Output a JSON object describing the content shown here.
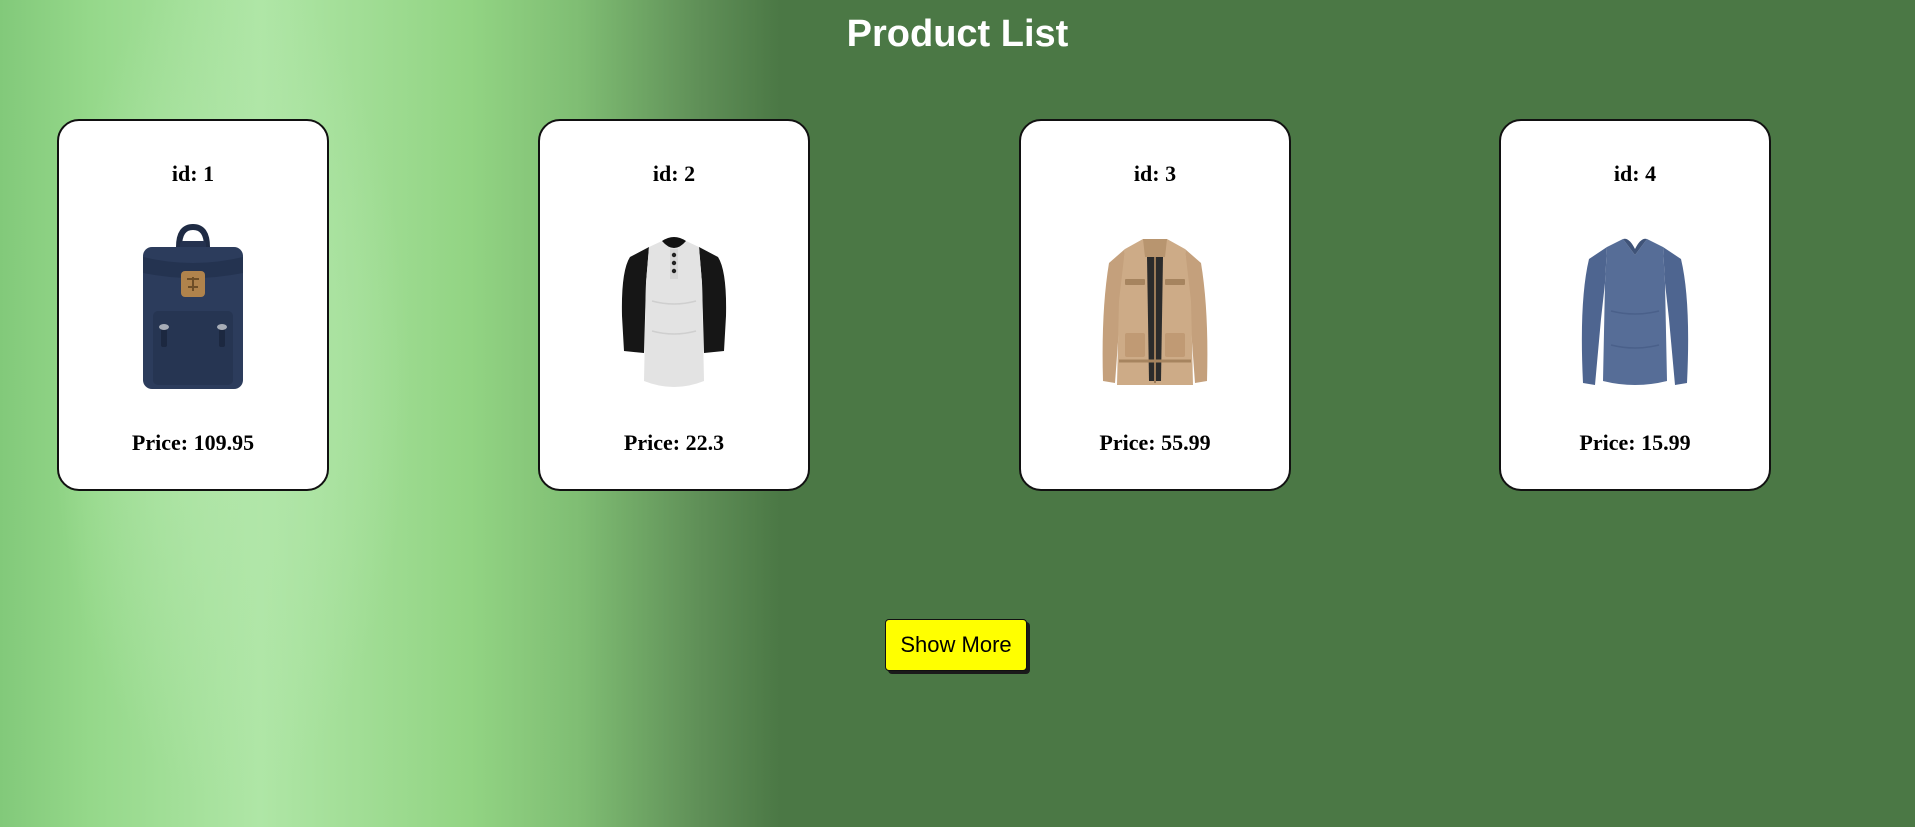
{
  "page": {
    "title": "Product List",
    "background_color": "#4b7845",
    "background_highlight": "#afe6a6"
  },
  "products": [
    {
      "id_label": "id: 1",
      "price_label": "Price: 109.95",
      "image_icon": "backpack-icon",
      "image_color": "#2c3c5c"
    },
    {
      "id_label": "id: 2",
      "price_label": "Price: 22.3",
      "image_icon": "raglan-shirt-icon",
      "image_color": "#e4e4e4"
    },
    {
      "id_label": "id: 3",
      "price_label": "Price: 55.99",
      "image_icon": "jacket-icon",
      "image_color": "#c9a885"
    },
    {
      "id_label": "id: 4",
      "price_label": "Price: 15.99",
      "image_icon": "long-sleeve-shirt-icon",
      "image_color": "#536a93"
    }
  ],
  "actions": {
    "show_more_label": "Show More",
    "show_more_color": "#ffff00"
  }
}
